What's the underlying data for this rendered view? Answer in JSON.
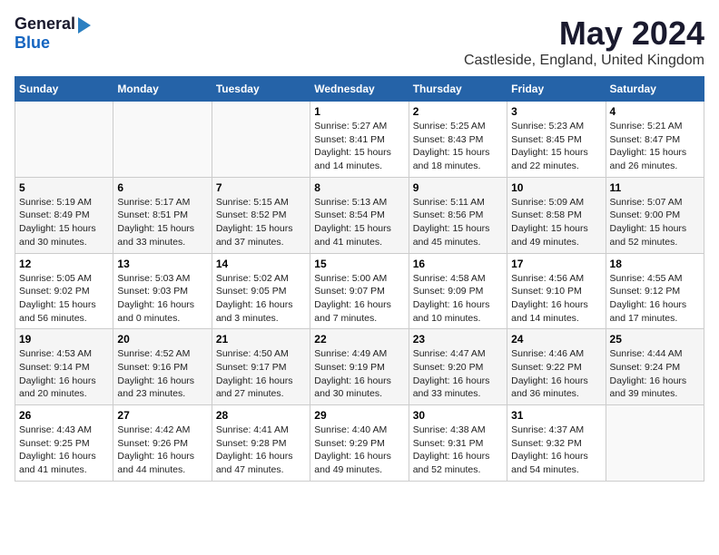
{
  "logo": {
    "general": "General",
    "blue": "Blue"
  },
  "title": "May 2024",
  "location": "Castleside, England, United Kingdom",
  "days_of_week": [
    "Sunday",
    "Monday",
    "Tuesday",
    "Wednesday",
    "Thursday",
    "Friday",
    "Saturday"
  ],
  "weeks": [
    [
      {
        "day": "",
        "info": ""
      },
      {
        "day": "",
        "info": ""
      },
      {
        "day": "",
        "info": ""
      },
      {
        "day": "1",
        "info": "Sunrise: 5:27 AM\nSunset: 8:41 PM\nDaylight: 15 hours\nand 14 minutes."
      },
      {
        "day": "2",
        "info": "Sunrise: 5:25 AM\nSunset: 8:43 PM\nDaylight: 15 hours\nand 18 minutes."
      },
      {
        "day": "3",
        "info": "Sunrise: 5:23 AM\nSunset: 8:45 PM\nDaylight: 15 hours\nand 22 minutes."
      },
      {
        "day": "4",
        "info": "Sunrise: 5:21 AM\nSunset: 8:47 PM\nDaylight: 15 hours\nand 26 minutes."
      }
    ],
    [
      {
        "day": "5",
        "info": "Sunrise: 5:19 AM\nSunset: 8:49 PM\nDaylight: 15 hours\nand 30 minutes."
      },
      {
        "day": "6",
        "info": "Sunrise: 5:17 AM\nSunset: 8:51 PM\nDaylight: 15 hours\nand 33 minutes."
      },
      {
        "day": "7",
        "info": "Sunrise: 5:15 AM\nSunset: 8:52 PM\nDaylight: 15 hours\nand 37 minutes."
      },
      {
        "day": "8",
        "info": "Sunrise: 5:13 AM\nSunset: 8:54 PM\nDaylight: 15 hours\nand 41 minutes."
      },
      {
        "day": "9",
        "info": "Sunrise: 5:11 AM\nSunset: 8:56 PM\nDaylight: 15 hours\nand 45 minutes."
      },
      {
        "day": "10",
        "info": "Sunrise: 5:09 AM\nSunset: 8:58 PM\nDaylight: 15 hours\nand 49 minutes."
      },
      {
        "day": "11",
        "info": "Sunrise: 5:07 AM\nSunset: 9:00 PM\nDaylight: 15 hours\nand 52 minutes."
      }
    ],
    [
      {
        "day": "12",
        "info": "Sunrise: 5:05 AM\nSunset: 9:02 PM\nDaylight: 15 hours\nand 56 minutes."
      },
      {
        "day": "13",
        "info": "Sunrise: 5:03 AM\nSunset: 9:03 PM\nDaylight: 16 hours\nand 0 minutes."
      },
      {
        "day": "14",
        "info": "Sunrise: 5:02 AM\nSunset: 9:05 PM\nDaylight: 16 hours\nand 3 minutes."
      },
      {
        "day": "15",
        "info": "Sunrise: 5:00 AM\nSunset: 9:07 PM\nDaylight: 16 hours\nand 7 minutes."
      },
      {
        "day": "16",
        "info": "Sunrise: 4:58 AM\nSunset: 9:09 PM\nDaylight: 16 hours\nand 10 minutes."
      },
      {
        "day": "17",
        "info": "Sunrise: 4:56 AM\nSunset: 9:10 PM\nDaylight: 16 hours\nand 14 minutes."
      },
      {
        "day": "18",
        "info": "Sunrise: 4:55 AM\nSunset: 9:12 PM\nDaylight: 16 hours\nand 17 minutes."
      }
    ],
    [
      {
        "day": "19",
        "info": "Sunrise: 4:53 AM\nSunset: 9:14 PM\nDaylight: 16 hours\nand 20 minutes."
      },
      {
        "day": "20",
        "info": "Sunrise: 4:52 AM\nSunset: 9:16 PM\nDaylight: 16 hours\nand 23 minutes."
      },
      {
        "day": "21",
        "info": "Sunrise: 4:50 AM\nSunset: 9:17 PM\nDaylight: 16 hours\nand 27 minutes."
      },
      {
        "day": "22",
        "info": "Sunrise: 4:49 AM\nSunset: 9:19 PM\nDaylight: 16 hours\nand 30 minutes."
      },
      {
        "day": "23",
        "info": "Sunrise: 4:47 AM\nSunset: 9:20 PM\nDaylight: 16 hours\nand 33 minutes."
      },
      {
        "day": "24",
        "info": "Sunrise: 4:46 AM\nSunset: 9:22 PM\nDaylight: 16 hours\nand 36 minutes."
      },
      {
        "day": "25",
        "info": "Sunrise: 4:44 AM\nSunset: 9:24 PM\nDaylight: 16 hours\nand 39 minutes."
      }
    ],
    [
      {
        "day": "26",
        "info": "Sunrise: 4:43 AM\nSunset: 9:25 PM\nDaylight: 16 hours\nand 41 minutes."
      },
      {
        "day": "27",
        "info": "Sunrise: 4:42 AM\nSunset: 9:26 PM\nDaylight: 16 hours\nand 44 minutes."
      },
      {
        "day": "28",
        "info": "Sunrise: 4:41 AM\nSunset: 9:28 PM\nDaylight: 16 hours\nand 47 minutes."
      },
      {
        "day": "29",
        "info": "Sunrise: 4:40 AM\nSunset: 9:29 PM\nDaylight: 16 hours\nand 49 minutes."
      },
      {
        "day": "30",
        "info": "Sunrise: 4:38 AM\nSunset: 9:31 PM\nDaylight: 16 hours\nand 52 minutes."
      },
      {
        "day": "31",
        "info": "Sunrise: 4:37 AM\nSunset: 9:32 PM\nDaylight: 16 hours\nand 54 minutes."
      },
      {
        "day": "",
        "info": ""
      }
    ]
  ]
}
